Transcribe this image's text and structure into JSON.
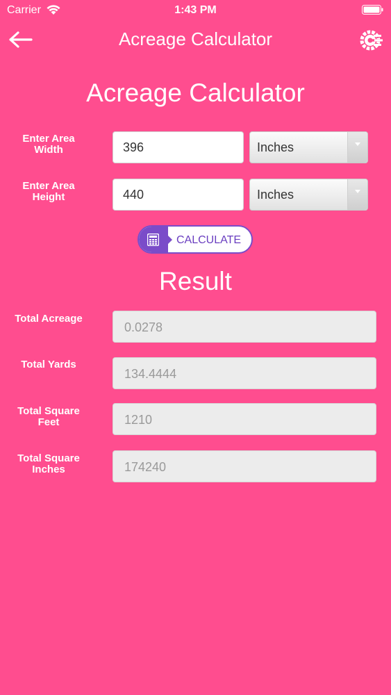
{
  "status_bar": {
    "carrier": "Carrier",
    "time": "1:43 PM"
  },
  "nav": {
    "title": "Acreage Calculator",
    "back_icon": "arrow-left-icon",
    "settings_icon": "gear-cog-icon"
  },
  "page_title": "Acreage Calculator",
  "inputs": {
    "width": {
      "label": "Enter Area Width",
      "value": "396",
      "unit": "Inches"
    },
    "height": {
      "label": "Enter Area Height",
      "value": "440",
      "unit": "Inches"
    }
  },
  "calculate_button": {
    "label": "CALCULATE",
    "icon": "calculator-icon"
  },
  "result": {
    "title": "Result",
    "items": [
      {
        "label": "Total Acreage",
        "value": "0.0278"
      },
      {
        "label": "Total Yards",
        "value": "134.4444"
      },
      {
        "label": "Total Square Feet",
        "value": "1210"
      },
      {
        "label": "Total Square Inches",
        "value": "174240"
      }
    ]
  },
  "colors": {
    "background": "#FF4D8F",
    "accent": "#7A4CC9",
    "text": "#FFFFFF"
  }
}
